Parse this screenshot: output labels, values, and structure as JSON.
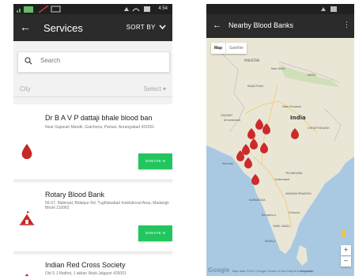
{
  "services": {
    "statusbar": {
      "time": "4:54"
    },
    "header": {
      "title": "Services",
      "sort_label": "SORT BY"
    },
    "search": {
      "placeholder": "Search"
    },
    "filter": {
      "city_label": "City",
      "select_label": "Select"
    },
    "cards": [
      {
        "name": "Dr B A V P dattaji bhale blood ban",
        "address": "Near Gajanan Mandir, Gatchoria, Parisar, Aurangabad 431001",
        "button": "DONATE N",
        "icon": "blood-drop-icon"
      },
      {
        "name": "Rotary Blood Bank",
        "address": "56-57, Mahinad, Bidaipur Rd, Tughlakabad Institutional Area, Madangir Bhuhi 110062",
        "button": "DONATE N",
        "icon": "tent-icon"
      },
      {
        "name": "Indian Red Cross Society",
        "address": "Old S J Mathot, J akkan Wadi Jalgaon 425001",
        "icon": "blood-drop-icon"
      }
    ],
    "colors": {
      "appbar": "#2b2b2b",
      "accent_green": "#22c55e",
      "drop_red": "#c62828"
    }
  },
  "map": {
    "header": {
      "title": "Nearby Blood Banks"
    },
    "tabs": {
      "map": "Map",
      "satellite": "Satellite"
    },
    "labels": {
      "india": "India",
      "pakistan": "PAKISTAN",
      "rajasthan": "RAJASTHAN",
      "new_delhi": "New Delhi",
      "nepal": "NEPAL",
      "gujarat": "GUJARAT",
      "ahmedabad": "Ahmedabad",
      "mumbai": "Mumbai",
      "hyderabad": "Hyderabad",
      "telangana": "TELANGANA",
      "karnataka": "KARNATAKA",
      "bengaluru": "Bengaluru",
      "tamil_nadu": "TAMIL NADU",
      "kerala": "KERALA",
      "chhattisgarh": "CHHATTISGARH",
      "uttar_pradesh": "Uttar Pradesh",
      "andhra": "ANDHRA PRADESH",
      "chennai": "Chennai",
      "sri_lanka": "Sri Lanka"
    },
    "zoom_in": "+",
    "zoom_out": "−",
    "footer": {
      "logo": "Google",
      "text": "Map data ©2017 Google  Terms of Use  Report a map error"
    },
    "colors": {
      "water": "#a9c9e3",
      "land": "#eae6d6",
      "marker": "#cc2b2b",
      "location": "#f4c430"
    }
  }
}
